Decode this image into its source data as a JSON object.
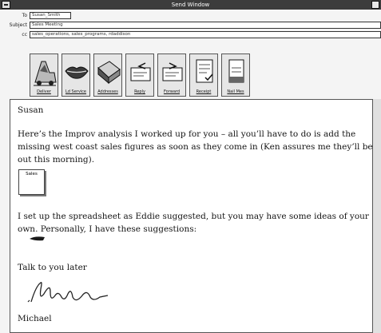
{
  "window": {
    "title": "Send Window"
  },
  "header": {
    "to": {
      "label": "To",
      "value": "Susan_Smith"
    },
    "subject": {
      "label": "Subject",
      "value": "Sales Meeting"
    },
    "cc": {
      "label": "cc",
      "value": "sales_operations, sales_programs, rdaddison"
    }
  },
  "toolbar": {
    "buttons": [
      {
        "label": "Deliver",
        "icon": "mail-truck-icon"
      },
      {
        "label": "Ld Service",
        "icon": "lips-icon"
      },
      {
        "label": "Addresses",
        "icon": "address-book-icon"
      },
      {
        "label": "Reply",
        "icon": "reply-icon"
      },
      {
        "label": "Forward",
        "icon": "forward-icon"
      },
      {
        "label": "Receipt",
        "icon": "receipt-icon"
      },
      {
        "label": "Nail Mes",
        "icon": "nail-message-icon"
      }
    ]
  },
  "message": {
    "greeting": "Susan",
    "para1_line1": "Here’s the Improv analysis I worked up for you – all you’ll have to do is add the",
    "para1_line2": "missing west coast sales figures as soon as they come in (Ken assures me they’ll be",
    "para1_line3": "out this morning).",
    "attachment_label": "Sales",
    "para2_line1": "I set up the spreadsheet as Eddie suggested, but you may have some ideas of your",
    "para2_line2": "own.  Personally, I have these suggestions:",
    "closing": "Talk to you later",
    "signature_name": "Michael"
  }
}
